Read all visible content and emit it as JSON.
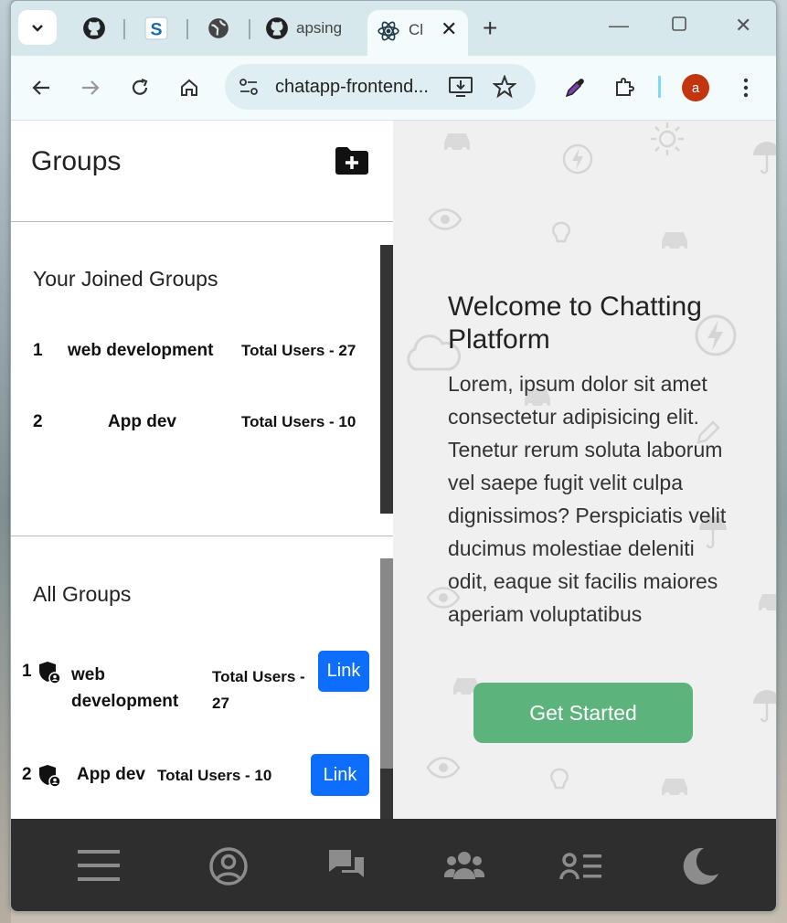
{
  "browser": {
    "tabs": [
      {
        "label": ""
      },
      {
        "label": ""
      },
      {
        "label": ""
      },
      {
        "label": "apsing"
      },
      {
        "label": "Cl"
      }
    ],
    "url": "chatapp-frontend..."
  },
  "profile": {
    "initial": "a"
  },
  "groups_panel": {
    "title": "Groups",
    "joined": {
      "title": "Your Joined Groups",
      "rows": [
        {
          "num": "1",
          "name": "web development",
          "total": "Total Users - 27"
        },
        {
          "num": "2",
          "name": "App dev",
          "total": "Total Users - 10"
        }
      ]
    },
    "all": {
      "title": "All Groups",
      "rows": [
        {
          "num": "1",
          "name": "web development",
          "total": "Total Users - 27",
          "button": "Link"
        },
        {
          "num": "2",
          "name": "App dev",
          "total": "Total Users - 10",
          "button": "Link"
        }
      ]
    }
  },
  "welcome": {
    "title": "Welcome to Chatting Platform",
    "text": "Lorem, ipsum dolor sit amet consectetur adipisicing elit. Tenetur rerum soluta laborum vel saepe fugit velit culpa dignissimos? Perspiciatis velit ducimus molestiae deleniti odit, eaque sit facilis maiores aperiam voluptatibus",
    "button": "Get Started"
  },
  "colors": {
    "link_button": "#0d6efd",
    "get_started": "#5cb37c",
    "bottom_bar": "#2e2e2e",
    "avatar": "#c2360f"
  }
}
